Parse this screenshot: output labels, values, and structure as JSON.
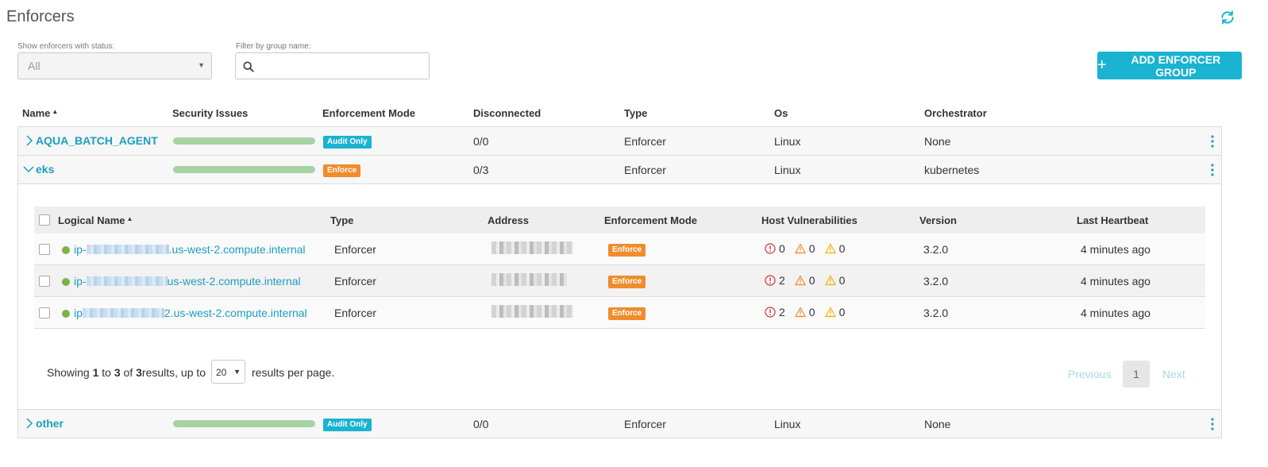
{
  "page": {
    "title": "Enforcers"
  },
  "filters": {
    "status_label": "Show enforcers with status:",
    "status_value": "All",
    "group_label": "Filter by group name:",
    "group_placeholder": "",
    "group_value": ""
  },
  "toolbar": {
    "add_label": "ADD ENFORCER GROUP"
  },
  "columns": {
    "name": "Name",
    "security_issues": "Security Issues",
    "enforcement_mode": "Enforcement Mode",
    "disconnected": "Disconnected",
    "type": "Type",
    "os": "Os",
    "orchestrator": "Orchestrator"
  },
  "groups": [
    {
      "name": "AQUA_BATCH_AGENT",
      "mode": "Audit Only",
      "disconnected": "0/0",
      "type": "Enforcer",
      "os": "Linux",
      "orchestrator": "None",
      "expanded": false
    },
    {
      "name": "eks",
      "mode": "Enforce",
      "disconnected": "0/3",
      "type": "Enforcer",
      "os": "Linux",
      "orchestrator": "kubernetes",
      "expanded": true
    },
    {
      "name": "other",
      "mode": "Audit Only",
      "disconnected": "0/0",
      "type": "Enforcer",
      "os": "Linux",
      "orchestrator": "None",
      "expanded": false
    }
  ],
  "sub_columns": {
    "logical_name": "Logical Name",
    "type": "Type",
    "address": "Address",
    "enforcement_mode": "Enforcement Mode",
    "host_vulnerabilities": "Host Vulnerabilities",
    "version": "Version",
    "last_heartbeat": "Last Heartbeat"
  },
  "enforcers": [
    {
      "name_prefix": "ip-",
      "name_suffix": ".us-west-2.compute.internal",
      "type": "Enforcer",
      "mode": "Enforce",
      "critical": "0",
      "high": "0",
      "medium": "0",
      "version": "3.2.0",
      "heartbeat": "4 minutes ago"
    },
    {
      "name_prefix": "ip-",
      "name_suffix": "us-west-2.compute.internal",
      "type": "Enforcer",
      "mode": "Enforce",
      "critical": "2",
      "high": "0",
      "medium": "0",
      "version": "3.2.0",
      "heartbeat": "4 minutes ago"
    },
    {
      "name_prefix": "ip",
      "name_suffix": "2.us-west-2.compute.internal",
      "type": "Enforcer",
      "mode": "Enforce",
      "critical": "2",
      "high": "0",
      "medium": "0",
      "version": "3.2.0",
      "heartbeat": "4 minutes ago"
    }
  ],
  "pagination": {
    "showing": "Showing",
    "from": "1",
    "to_word": "to",
    "to": "3",
    "of_word": "of",
    "total": "3",
    "results_up_to": "results, up to",
    "per_page": "20",
    "per_page_suffix": "results per page.",
    "previous": "Previous",
    "current_page": "1",
    "next": "Next"
  },
  "colors": {
    "accent": "#1ab3d1",
    "link": "#1a9fc0",
    "audit_badge": "#1ab3d1",
    "enforce_badge": "#f08c2c",
    "security_bar": "#a7d3a3",
    "status_online": "#7cb342",
    "critical": "#d32f2f",
    "high": "#f08c2c",
    "medium": "#e6b800"
  },
  "icons": {
    "refresh": "refresh-icon",
    "search": "search-icon",
    "plus": "plus-icon",
    "expand": "chevron-right-icon",
    "collapse": "chevron-down-icon",
    "menu": "kebab-icon",
    "critical": "exclamation-circle-icon",
    "warning": "warning-triangle-icon"
  }
}
